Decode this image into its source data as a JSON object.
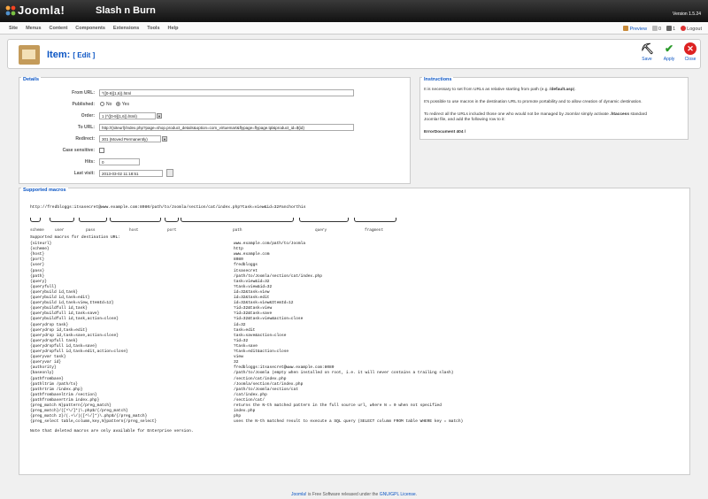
{
  "header": {
    "logo_text": "Joomla!",
    "site_name": "Slash n Burn",
    "version": "Version 1.5.24"
  },
  "menu": [
    "Site",
    "Menus",
    "Content",
    "Components",
    "Extensions",
    "Tools",
    "Help"
  ],
  "status": {
    "preview": "Preview",
    "messages": "0",
    "users": "1",
    "logout": "Logout"
  },
  "toolbar": {
    "title": "Item:",
    "subtitle": "[ Edit ]",
    "save": "Save",
    "apply": "Apply",
    "close": "Close"
  },
  "details": {
    "legend": "Details",
    "from_url_label": "From URL:",
    "from_url_value": "^([0-9]{1,6}).html",
    "published_label": "Published:",
    "published_no": "No",
    "published_yes": "Yes",
    "order_label": "Order:",
    "order_value": "1 (^([0-9]{1,6}).html)",
    "to_url_label": "To URL:",
    "to_url_value": "http://{siteurl}/index.php?page=shop.product_details&option=com_virtuemart&flypage=flypage.tpl&product_id=${id}",
    "redirect_label": "Redirect:",
    "redirect_value": "301 (Moved Permanently)",
    "case_label": "Case sensitive:",
    "hits_label": "Hits:",
    "hits_value": "0",
    "last_visit_label": "Last visit:",
    "last_visit_value": "2013-03-02 11:18:51"
  },
  "instructions": {
    "legend": "Instructions",
    "p1_pre": "It is necessary to set from URLs as relative starting from path (e.g.",
    "p1_code": "/default.asp",
    "p1_post": ").",
    "p2": "It's possible to use macros in the destination URL to promote portability and to allow creation of dynamic destination.",
    "p3a": "To redirect all the URLs included those one who would not be managed by Joomla! simply activate",
    "p3_code": ".htaccess",
    "p3b": "standard",
    "p3c": "Joomla! file, and add the following row to it:",
    "error_doc": "ErrorDocument 404 /"
  },
  "macros": {
    "legend": "Supported macros",
    "example_url": "http://fredbloggs:itsasecret@www.example.com:8080/path/to/Joomla/section/cat/index.php?task=view&id=32#anchorthis",
    "parts": [
      "scheme",
      "user",
      "pass",
      "host",
      "port",
      "path",
      "query",
      "fragment"
    ],
    "heading": "Supported macros for destination URL:",
    "rows": [
      {
        "m": "{siteurl}",
        "v": "www.example.com/path/to/Joomla",
        "del": false
      },
      {
        "m": "{scheme}",
        "v": "http",
        "del": false
      },
      {
        "m": "{host}",
        "v": "www.example.com",
        "del": false
      },
      {
        "m": "{port}",
        "v": "8080",
        "del": false
      },
      {
        "m": "{user}",
        "v": "fredbloggs",
        "del": false
      },
      {
        "m": "{pass}",
        "v": "itsasecret",
        "del": false
      },
      {
        "m": "{path}",
        "v": "/path/to/Joomla/section/cat/index.php",
        "del": false
      },
      {
        "m": "{query}",
        "v": "task=view&id=32",
        "del": false
      },
      {
        "m": "{queryfull}",
        "v": "?task=view&id=32",
        "del": false
      },
      {
        "m": "{querybuild id,task}",
        "v": "id=32&task=view",
        "del": false
      },
      {
        "m": "{querybuild id,task=edit}",
        "v": "id=32&task=edit",
        "del": false
      },
      {
        "m": "{querybuild id,task=view,ItemId=12}",
        "v": "id=32&task=view&ItemId=12",
        "del": false
      },
      {
        "m": "{querybuildfull id,task}",
        "v": "?id=32&task=view",
        "del": false
      },
      {
        "m": "{querybuildfull id,task=save}",
        "v": "?id=32&task=save",
        "del": false
      },
      {
        "m": "{querybuildfull id,task,action=close}",
        "v": "?id=32&task=view&action=close",
        "del": false
      },
      {
        "m": "{querydrop task}",
        "v": "id=32",
        "del": true
      },
      {
        "m": "{querydrop id,task=edit}",
        "v": "task=edit",
        "del": true
      },
      {
        "m": "{querydrop id,task=save,action=close}",
        "v": "task=save&action=close",
        "del": true
      },
      {
        "m": "{querydropfull task}",
        "v": "?id=32",
        "del": true
      },
      {
        "m": "{querydropfull id,task=save}",
        "v": "?task=save",
        "del": true
      },
      {
        "m": "{querydropfull id,task=edit,action=close}",
        "v": "?task=edit&action=close",
        "del": true
      },
      {
        "m": "{queryvar task}",
        "v": "view",
        "del": false
      },
      {
        "m": "{queryvar id}",
        "v": "32",
        "del": false
      },
      {
        "m": "{authority}",
        "v": "fredbloggs:itsasecret@www.example.com:8080",
        "del": false
      },
      {
        "m": "{baseonly}",
        "v": "/path/to/Joomla (empty when installed on root, i.e. it will never contains a trailing slash)",
        "del": false
      },
      {
        "m": "{pathfrombase}",
        "v": "/section/cat/index.php",
        "del": false
      },
      {
        "m": "{pathltrim /path/to}",
        "v": "/Joomla/section/cat/index.php",
        "del": false
      },
      {
        "m": "{pathrtrim /index.php}",
        "v": "/path/to/Joomla/section/cat",
        "del": false
      },
      {
        "m": "{pathfrombaseltrim /section}",
        "v": "/cat/index.php",
        "del": true
      },
      {
        "m": "{pathfrombasertrim index.php}",
        "v": "/section/cat/",
        "del": true
      },
      {
        "m": "{preg_match N}pattern{/preg_match}",
        "v": "returns the N-th matched pattern in the full source url, where N = 0 when not specified",
        "del": true
      },
      {
        "m": "{preg_match}/([^\\/]*)\\.php$/{/preg_match}",
        "v": "index.php",
        "del": true
      },
      {
        "m": "{preg_match 2}/(.+\\/)([^\\/]*)\\.php$/{/preg_match}",
        "v": "php",
        "del": true
      },
      {
        "m": "{preg_select table,column,key,N}pattern{/preg_select}",
        "v": "uses the N-th matched result to execute a SQL query (SELECT column FROM table WHERE key = match)",
        "del": true
      }
    ],
    "note": "Note that deleted macros are only available for Enterprise version."
  },
  "footer": {
    "pre": "Joomla!",
    "mid": " is Free Software released under the ",
    "link": "GNU/GPL License",
    "post": "."
  }
}
